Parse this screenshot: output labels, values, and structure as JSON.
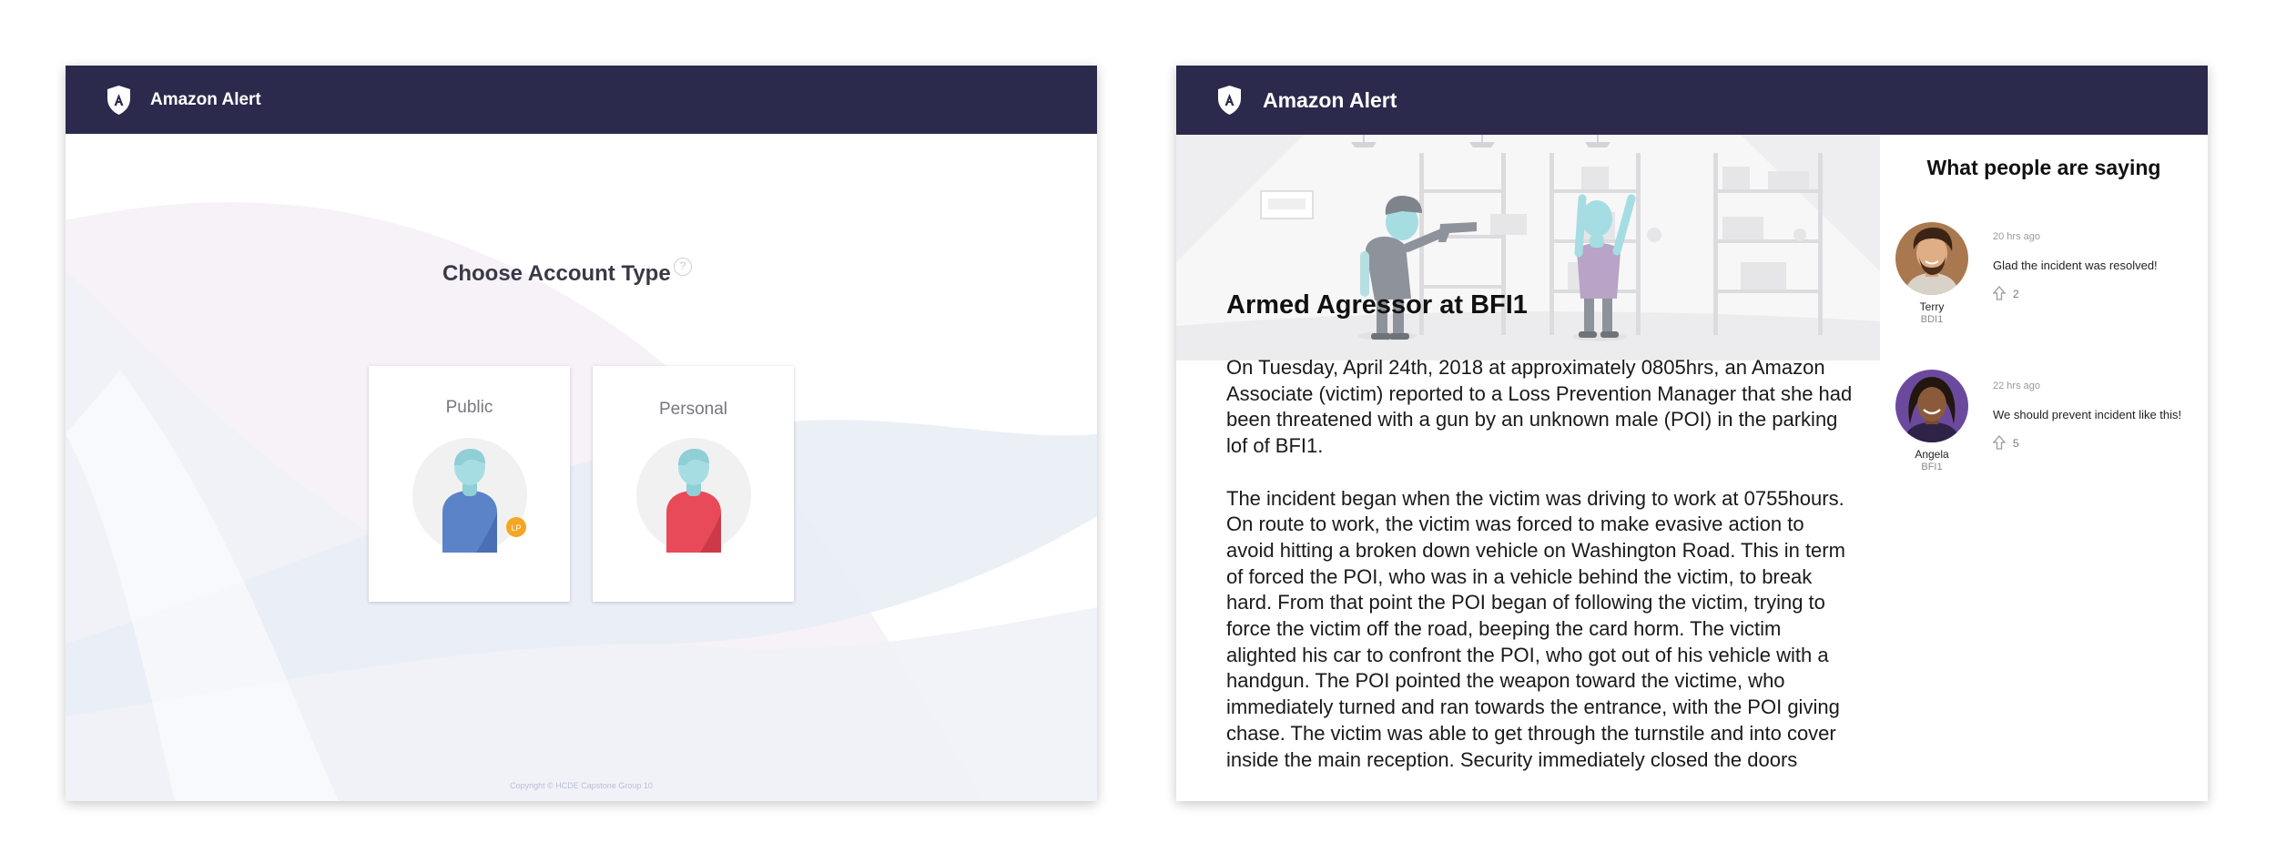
{
  "screen_left": {
    "app": {
      "title": "Amazon Alert",
      "logo_letter": "A"
    },
    "main": {
      "title": "Choose Account Type",
      "help_glyph": "?",
      "cards": [
        {
          "label": "Public",
          "badge": "LP",
          "accent": "#4f7fc9"
        },
        {
          "label": "Personal",
          "accent": "#e84a59"
        }
      ]
    },
    "footer": {
      "copyright": "Copyright © HCDE Capstone Group 10"
    }
  },
  "screen_right": {
    "app": {
      "title": "Amazon Alert",
      "logo_letter": "A"
    },
    "article": {
      "title": "Armed Agressor at BFI1",
      "paragraphs": [
        "On Tuesday, April 24th, 2018 at approximately 0805hrs, an Amazon Associate (victim) reported to a Loss Prevention Manager that she had been threatened with a gun by an unknown male (POI) in the parking lof of BFI1.",
        "The incident began when the victim was driving to work at 0755hours. On route to work, the victim was forced to make evasive action to avoid hitting a broken down vehicle on Washington Road. This in term of forced the POI, who was in a vehicle behind the victim, to break hard. From that point the POI began of following the victim, trying to force the victim off the road, beeping the card horm. The victim alighted his car to confront the POI, who got out of his vehicle with a handgun. The POI pointed the weapon toward the victime, who immediately turned and ran towards the entrance, with the POI giving chase. The victim was able to get through the turnstile and into cover inside the main reception. Security immediately closed the doors"
      ]
    },
    "sidebar": {
      "title": "What people are saying",
      "comments": [
        {
          "name": "Terry",
          "branch": "BDI1",
          "time": "20 hrs ago",
          "text": "Glad the incident was resolved!",
          "votes": "2"
        },
        {
          "name": "Angela",
          "branch": "BFI1",
          "time": "22 hrs ago",
          "text": "We should prevent incident like this!",
          "votes": "5"
        }
      ]
    }
  },
  "colors": {
    "navbar": "#2b2a4c",
    "badge": "#f5a623",
    "wave_blue": "#dfe5f1",
    "wave_pink": "#f3edf5"
  },
  "icons": [
    "shield-logo-icon",
    "help-icon",
    "upvote-arrow-icon",
    "user-avatar-icon"
  ]
}
